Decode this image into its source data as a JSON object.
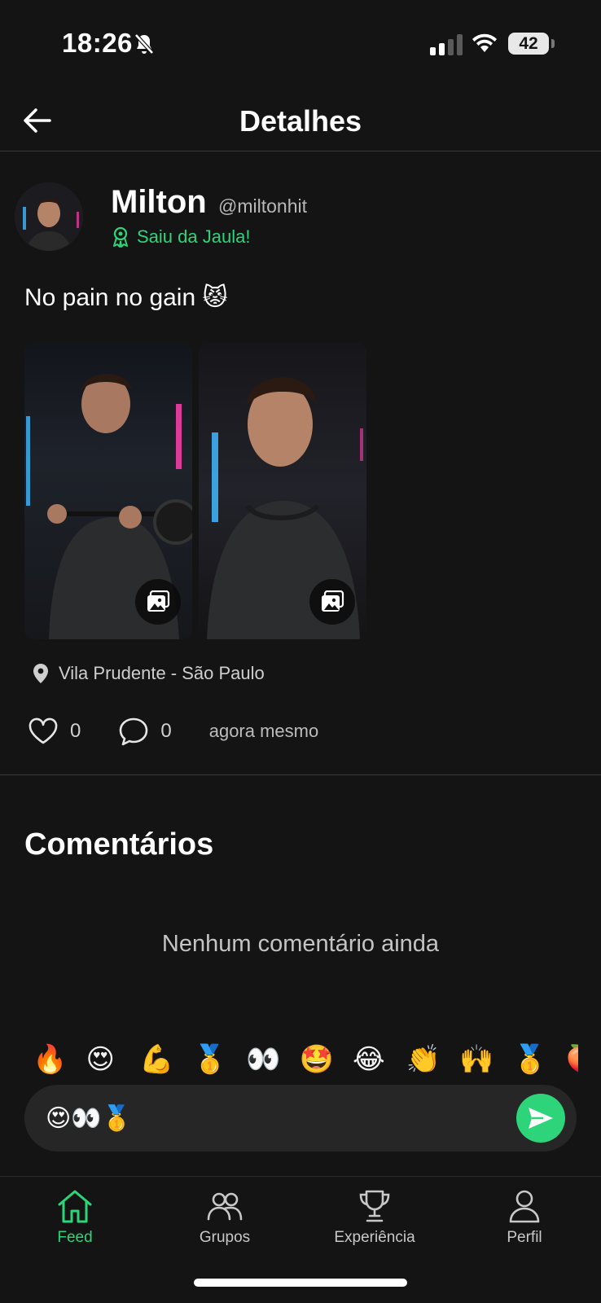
{
  "status_bar": {
    "time": "18:26",
    "battery": "42",
    "icons": [
      "bell-slash-icon",
      "signal-icon",
      "wifi-icon",
      "battery-icon"
    ]
  },
  "header": {
    "title": "Detalhes",
    "back_icon": "arrow-left-icon"
  },
  "post": {
    "user_name": "Milton",
    "user_handle": "@miltonhit",
    "badge_label": "Saiu da Jaula!",
    "badge_icon": "award-ribbon-icon",
    "text": "No pain no gain 😾",
    "photos": [
      {
        "icon": "image-gallery-icon"
      },
      {
        "icon": "image-gallery-icon"
      }
    ],
    "location": "Vila Prudente - São Paulo",
    "likes": "0",
    "comments": "0",
    "timestamp": "agora mesmo"
  },
  "comments_section": {
    "title": "Comentários",
    "empty_text": "Nenhum comentário ainda"
  },
  "emoji_picker": [
    "🔥",
    "😍",
    "💪",
    "🥇",
    "👀",
    "🤩",
    "😂",
    "👏",
    "🙌",
    "🥇",
    "🍑"
  ],
  "comment_input": {
    "value": "😍👀🥇"
  },
  "bottom_nav": {
    "items": [
      {
        "label": "Feed",
        "icon": "home-icon",
        "active": true
      },
      {
        "label": "Grupos",
        "icon": "users-icon",
        "active": false
      },
      {
        "label": "Experiência",
        "icon": "trophy-icon",
        "active": false
      },
      {
        "label": "Perfil",
        "icon": "user-icon",
        "active": false
      }
    ]
  },
  "colors": {
    "background": "#141414",
    "accent": "#2ed47a",
    "input_bg": "#262626",
    "divider": "#3a3a3a"
  }
}
